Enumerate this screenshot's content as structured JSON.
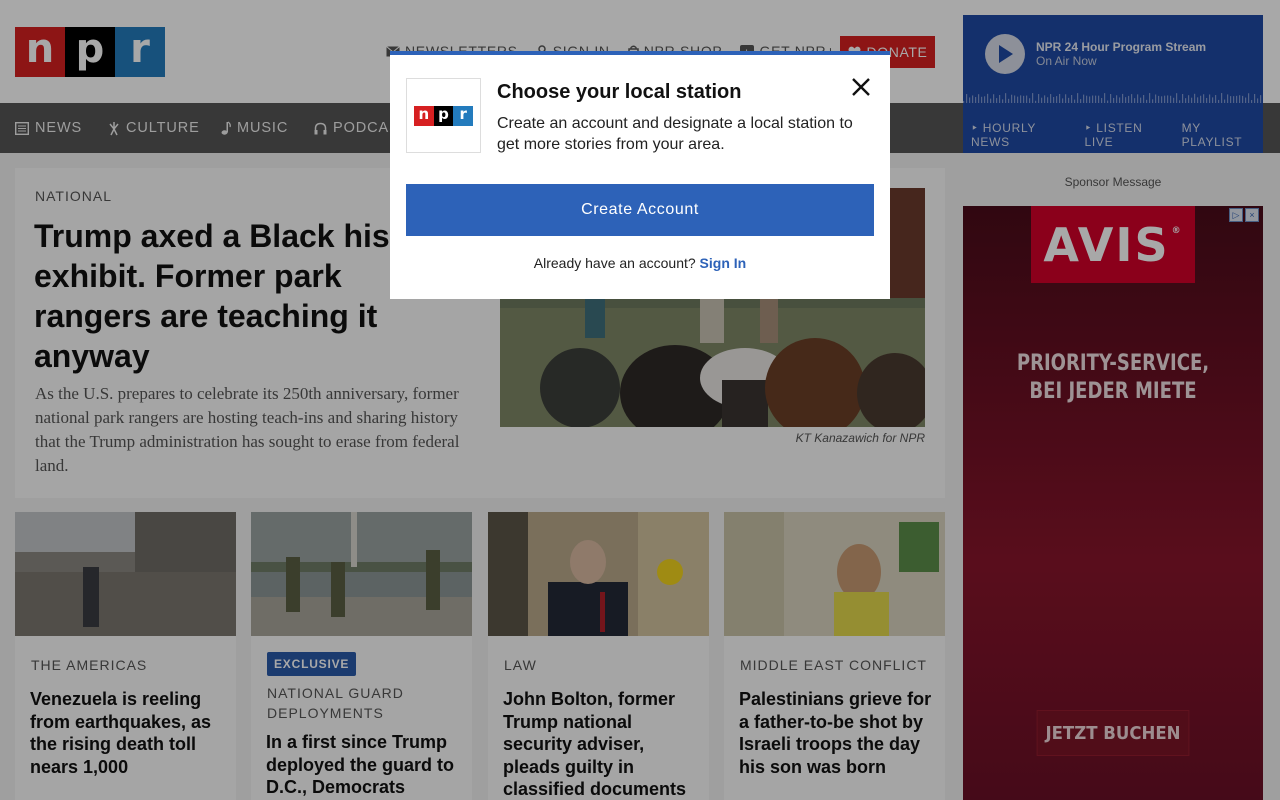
{
  "header": {
    "logo_letters": [
      "n",
      "p",
      "r"
    ],
    "logo_colors": [
      "#d62021",
      "#000000",
      "#237bbd"
    ],
    "utility_links": [
      {
        "icon": "envelope-icon",
        "label": "NEWSLETTERS"
      },
      {
        "icon": "user-icon",
        "label": "SIGN IN"
      },
      {
        "icon": "shopping-bag-icon",
        "label": "NPR SHOP"
      },
      {
        "icon": "device-icon",
        "label": "GET NPR+"
      }
    ],
    "donate": {
      "icon": "heart-icon",
      "label": "DONATE"
    }
  },
  "nav": {
    "items": [
      {
        "icon": "newspaper-icon",
        "label": "NEWS"
      },
      {
        "icon": "culture-icon",
        "label": "CULTURE"
      },
      {
        "icon": "music-note-icon",
        "label": "MUSIC"
      },
      {
        "icon": "headphones-icon",
        "label": "PODCAS"
      }
    ]
  },
  "player": {
    "stream_title": "NPR 24 Hour Program Stream",
    "stream_subtitle": "On Air Now",
    "links": [
      "‣ HOURLY NEWS",
      "‣ LISTEN LIVE",
      "MY PLAYLIST"
    ],
    "accent": "#1f4aa5"
  },
  "sponsor": {
    "label": "Sponsor Message",
    "ad_logo": "AVIS",
    "ad_registered": "®",
    "ad_headline": "PRIORITY-SERVICE, BEI JEDER MIETE",
    "ad_cta": "JETZT BUCHEN"
  },
  "featured": {
    "kicker": "NATIONAL",
    "title": "Trump axed a Black history exhibit. Former park rangers are teaching it anyway",
    "teaser": "As the U.S. prepares to celebrate its 250th anniversary, former national park rangers are hosting teach-ins and sharing history that the Trump administration has sought to erase from federal land.",
    "photo_credit": "KT Kanazawich for NPR"
  },
  "cards": [
    {
      "slug": "THE AMERICAS",
      "badge": "",
      "headline": "Venezuela is reeling from earthquakes, as the rising death toll nears 1,000"
    },
    {
      "slug": "NATIONAL GUARD DEPLOYMENTS",
      "badge": "EXCLUSIVE",
      "headline": "In a first since Trump deployed the guard to D.C., Democrats"
    },
    {
      "slug": "LAW",
      "badge": "",
      "headline": "John Bolton, former Trump national security adviser, pleads guilty in classified documents"
    },
    {
      "slug": "MIDDLE EAST CONFLICT",
      "badge": "",
      "headline": "Palestinians grieve for a father-to-be shot by Israeli troops the day his son was born"
    }
  ],
  "modal": {
    "title": "Choose your local station",
    "body": "Create an account and designate a local station to get more stories from your area.",
    "create_label": "Create Account",
    "signin_prompt": "Already have an account?",
    "signin_link": "Sign In",
    "accent": "#2d62b8"
  }
}
